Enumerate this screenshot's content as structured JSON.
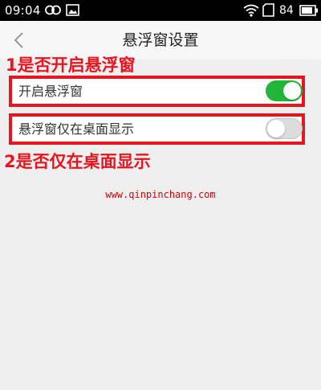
{
  "status_bar": {
    "time": "09:04",
    "battery_level": "84",
    "icons": [
      "loop-icon",
      "gallery-icon",
      "wifi-icon",
      "sim-card-icon",
      "battery-icon"
    ]
  },
  "nav": {
    "back_icon": "chevron-left-icon",
    "title": "悬浮窗设置"
  },
  "annotations": {
    "first": "1是否开启悬浮窗",
    "second": "2是否仅在桌面显示"
  },
  "settings": [
    {
      "label": "开启悬浮窗",
      "enabled": true
    },
    {
      "label": "悬浮窗仅在桌面显示",
      "enabled": false
    }
  ],
  "watermark": "www.qinpinchang.com",
  "colors": {
    "annotation_red": "#e8141e",
    "toggle_on": "#21b53a",
    "toggle_off": "#dcdcdc",
    "background": "#efefef"
  }
}
